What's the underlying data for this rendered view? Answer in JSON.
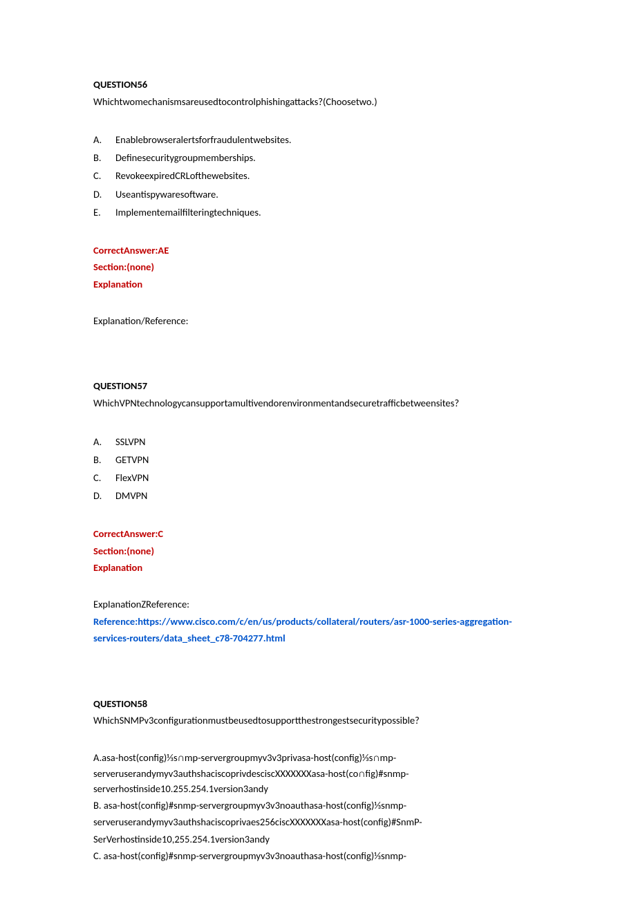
{
  "q56": {
    "header": "QUESTION56",
    "prompt": "Whichtwomechanismsareusedtocontrolphishingattacks?(Choosetwo.)",
    "opts": [
      {
        "l": "A.",
        "t": "Enablebrowseralertsforfraudulentwebsites."
      },
      {
        "l": "B.",
        "t": "Definesecuritygroupmemberships."
      },
      {
        "l": "C.",
        "t": "RevokeexpiredCRLofthewebsites."
      },
      {
        "l": "D.",
        "t": "Useantispywaresoftware."
      },
      {
        "l": "E.",
        "t": "Implementemailfilteringtechniques."
      }
    ],
    "ans": "CorrectAnswer:AE",
    "sec": "Section:(none)",
    "exp": "Explanation",
    "expref": "Explanation/Reference:"
  },
  "q57": {
    "header": "QUESTION57",
    "prompt": "WhichVPNtechnologycansupportamultivendorenvironmentandsecuretrafficbetweensites?",
    "opts": [
      {
        "l": "A.",
        "t": "SSLVPN"
      },
      {
        "l": "B.",
        "t": "GETVPN"
      },
      {
        "l": "C.",
        "t": "FlexVPN"
      },
      {
        "l": "D.",
        "t": "DMVPN"
      }
    ],
    "ans": "CorrectAnswer:C",
    "sec": "Section:(none)",
    "exp": "Explanation",
    "expref": "ExpIanationZReference:",
    "refline1": "Reference:https://www.cisco.com/c/en/us/products/collateral/routers/asr-1000-series-aggregation-",
    "refline2": "services-routers/data_sheet_c78-704277.html"
  },
  "q58": {
    "header": "QUESTION58",
    "prompt": "WhichSNMPv3configurationmustbeusedtosupportthestrongestsecuritypossible?",
    "lines": [
      "A.asa-host(config)⅓s∩mp-servergroupmyv3v3privasa-host(config)⅓s∩mp-",
      "serveruserandymyv3authshaciscoprivdesciscXXXXXXXasa-host(co∩fig)#snmp-",
      "serverhostinside10.255.254.1version3andy",
      "B.    asa-host(config)#snmp-servergroupmyv3v3noauthasa-host(config)⅓snmp-",
      "serveruserandymyv3authshaciscoprivaes256ciscXXXXXXXasa-host(config)#SnmP-",
      "SerVerhostinside10,255.254.1version3andy",
      "C.    asa-host(config)#snmp-servergroupmyv3v3noauthasa-host(config)⅓snmp-"
    ]
  }
}
